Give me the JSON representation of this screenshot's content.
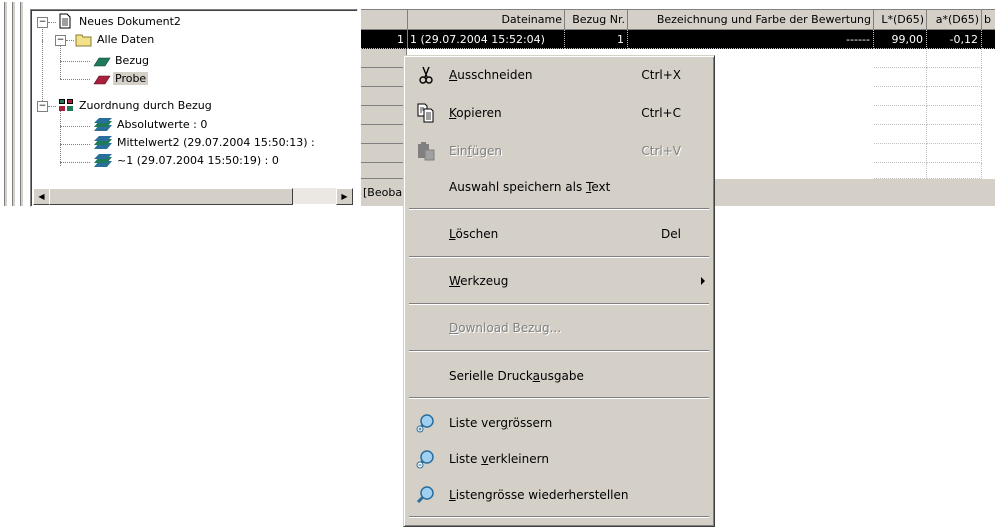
{
  "tree": {
    "root": "Neues Dokument2",
    "alle_daten": "Alle Daten",
    "bezug": "Bezug",
    "probe": "Probe",
    "zuordnung": "Zuordnung durch Bezug",
    "absolutwerte": "Absolutwerte : 0",
    "mittelwert": "Mittelwert2 (29.07.2004 15:50:13) :",
    "tilde": "~1 (29.07.2004 15:50:19) : 0"
  },
  "grid": {
    "headers": [
      "Dateiname",
      "Bezug Nr.",
      "Bezeichnung und Farbe der Bewertung",
      "L*(D65)",
      "a*(D65)",
      "b"
    ],
    "selected_row": {
      "dateiname": "1 (29.07.2004 15:52:04)",
      "bezug_nr": "1",
      "bezeichnung": "------",
      "l": "99,00",
      "a": "-0,12"
    },
    "status_text": "[Beoba"
  },
  "menu": {
    "cut": {
      "label": "Ausschneiden",
      "ul": "A",
      "rest": "usschneiden",
      "shortcut": "Ctrl+X"
    },
    "copy": {
      "label": "Kopieren",
      "ul": "K",
      "rest": "opieren",
      "shortcut": "Ctrl+C"
    },
    "paste": {
      "pre": "Ein",
      "ul": "f",
      "rest": "ügen",
      "shortcut": "Ctrl+V"
    },
    "save_text": {
      "pre": "Auswahl speichern als ",
      "ul": "T",
      "rest": "ext"
    },
    "delete": {
      "ul": "L",
      "rest": "öschen",
      "shortcut": "Del"
    },
    "tool": {
      "ul": "W",
      "rest": "erkzeug"
    },
    "download": {
      "ul": "D",
      "rest": "ownload Bezug..."
    },
    "serial": {
      "pre": "Serielle Druck",
      "ul": "a",
      "rest": "usgabe"
    },
    "enlarge": {
      "pre": "Liste ver",
      "ul": "g",
      "rest": "rössern"
    },
    "shrink": {
      "pre": "Liste ",
      "ul": "v",
      "rest": "erkleinern"
    },
    "restore": {
      "ul": "L",
      "rest": "istengrösse wiederherstellen"
    }
  },
  "colors": {
    "menu_bg": "#d4d0c8",
    "selection": "#000000",
    "disabled": "#808080"
  }
}
